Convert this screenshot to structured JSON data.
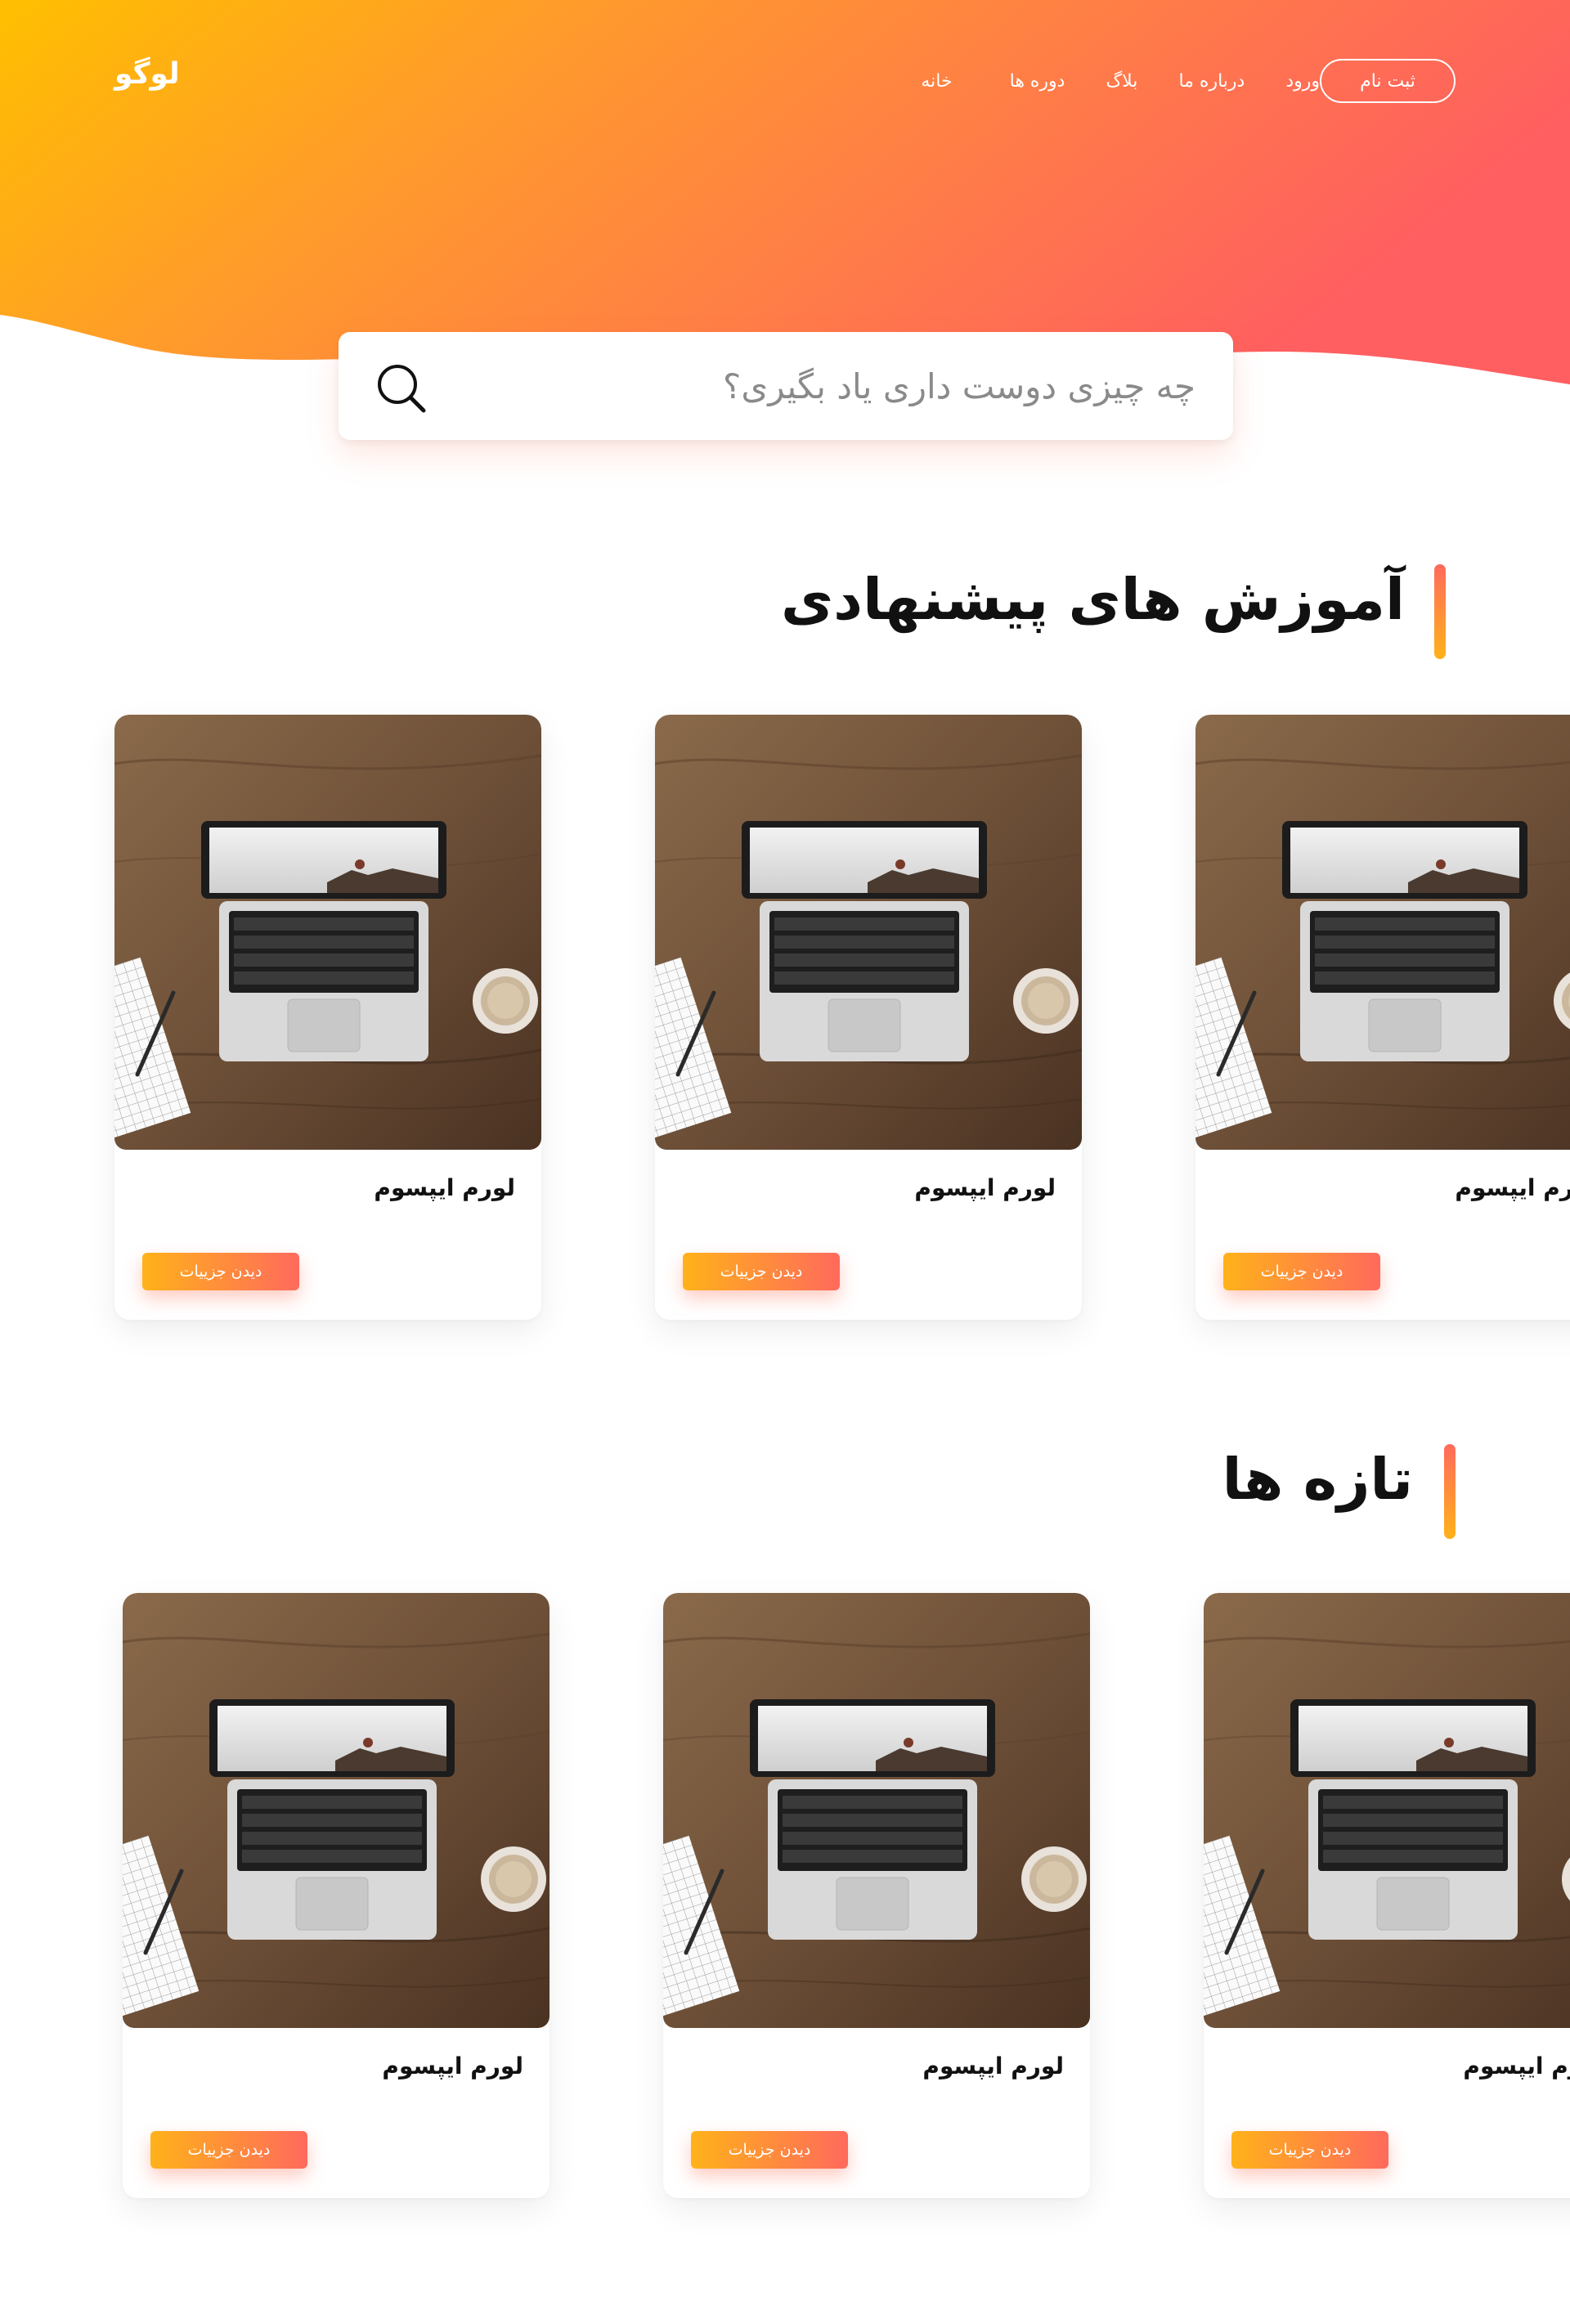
{
  "header": {
    "logo": "لوگو",
    "nav": [
      "خانه",
      "دوره ها",
      "بلاگ",
      "درباره ما",
      "ورود"
    ],
    "signup_label": "ثبت نام"
  },
  "search": {
    "placeholder": "چه چیزی دوست داری یاد بگیری؟",
    "icon": "search-icon"
  },
  "sections": [
    {
      "title": "آموزش های پیشنهادی",
      "cards": [
        {
          "title": "لورم ایپسوم",
          "button": "دیدن جزییات"
        },
        {
          "title": "لورم ایپسوم",
          "button": "دیدن جزییات"
        },
        {
          "title": "لورم ایپسوم",
          "button": "دیدن جزییات"
        }
      ]
    },
    {
      "title": "تازه ها",
      "cards": [
        {
          "title": "لورم ایپسوم",
          "button": "دیدن جزییات"
        },
        {
          "title": "لورم ایپسوم",
          "button": "دیدن جزییات"
        },
        {
          "title": "لورم ایپسوم",
          "button": "دیدن جزییات"
        }
      ]
    }
  ],
  "colors": {
    "gradient_start": "#ffbf00",
    "gradient_end": "#ff5f60",
    "button_gradient_start": "#ffb21a",
    "button_gradient_end": "#ff6a5c"
  }
}
